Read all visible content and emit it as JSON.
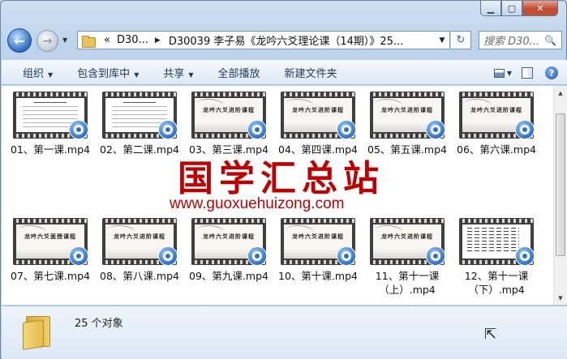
{
  "window": {
    "minimize_label": "▁",
    "maximize_label": "▢",
    "close_label": "✕"
  },
  "nav": {
    "back_icon": "←",
    "forward_icon": "→",
    "history_icon": "▼"
  },
  "address": {
    "overflow": "«",
    "crumb1": "D30...",
    "crumb2": "D30039 李子易《龙吟六爻理论课（14期）》25...",
    "sep": "▶",
    "drop": "▼"
  },
  "refresh_icon": "↻",
  "search": {
    "placeholder": "搜索 D30...",
    "icon": "🔍"
  },
  "toolbar": {
    "organize": "组织",
    "include_in_library": "包含到库中",
    "share": "共享",
    "play_all": "全部播放",
    "new_folder": "新建文件夹",
    "arrow": "▼",
    "help": "?"
  },
  "files": [
    {
      "name": "01、第一课.mp4",
      "thumb": "doc"
    },
    {
      "name": "02、第二课.mp4",
      "thumb": "doc"
    },
    {
      "name": "03、第三课.mp4",
      "thumb": "scroll",
      "thumb_title": "龙吟六爻进阶课程"
    },
    {
      "name": "04、第四课.mp4",
      "thumb": "scroll",
      "thumb_title": "龙吟六爻进阶课程"
    },
    {
      "name": "05、第五课.mp4",
      "thumb": "scroll",
      "thumb_title": "龙吟六爻进阶课程"
    },
    {
      "name": "06、第六课.mp4",
      "thumb": "scroll",
      "thumb_title": "龙吟六爻进阶课程"
    },
    {
      "name": "07、第七课.mp4",
      "thumb": "scroll",
      "thumb_title": "龙吟六爻面授课程"
    },
    {
      "name": "08、第八课.mp4",
      "thumb": "scroll",
      "thumb_title": "龙吟六爻进阶课程"
    },
    {
      "name": "09、第九课.mp4",
      "thumb": "scroll",
      "thumb_title": "龙吟六爻进阶课程"
    },
    {
      "name": "10、第十课.mp4",
      "thumb": "scroll",
      "thumb_title": "龙吟六爻进阶课程"
    },
    {
      "name": "11、第十一课（上）.mp4",
      "thumb": "scroll",
      "thumb_title": "龙吟六爻进阶课程"
    },
    {
      "name": "12、第十一课（下）.mp4",
      "thumb": "table"
    }
  ],
  "watermark": {
    "cn": "国学汇总站",
    "url": "www.guoxuehuizong.com"
  },
  "status": {
    "count_text": "25 个对象"
  },
  "scrollbar": {
    "up": "▲",
    "down": "▼"
  },
  "cursor_icon": "⇱",
  "colors": {
    "watermark": "#c00000",
    "play_badge": "#2f6fc7",
    "window_frame": "#b9d1ea"
  }
}
